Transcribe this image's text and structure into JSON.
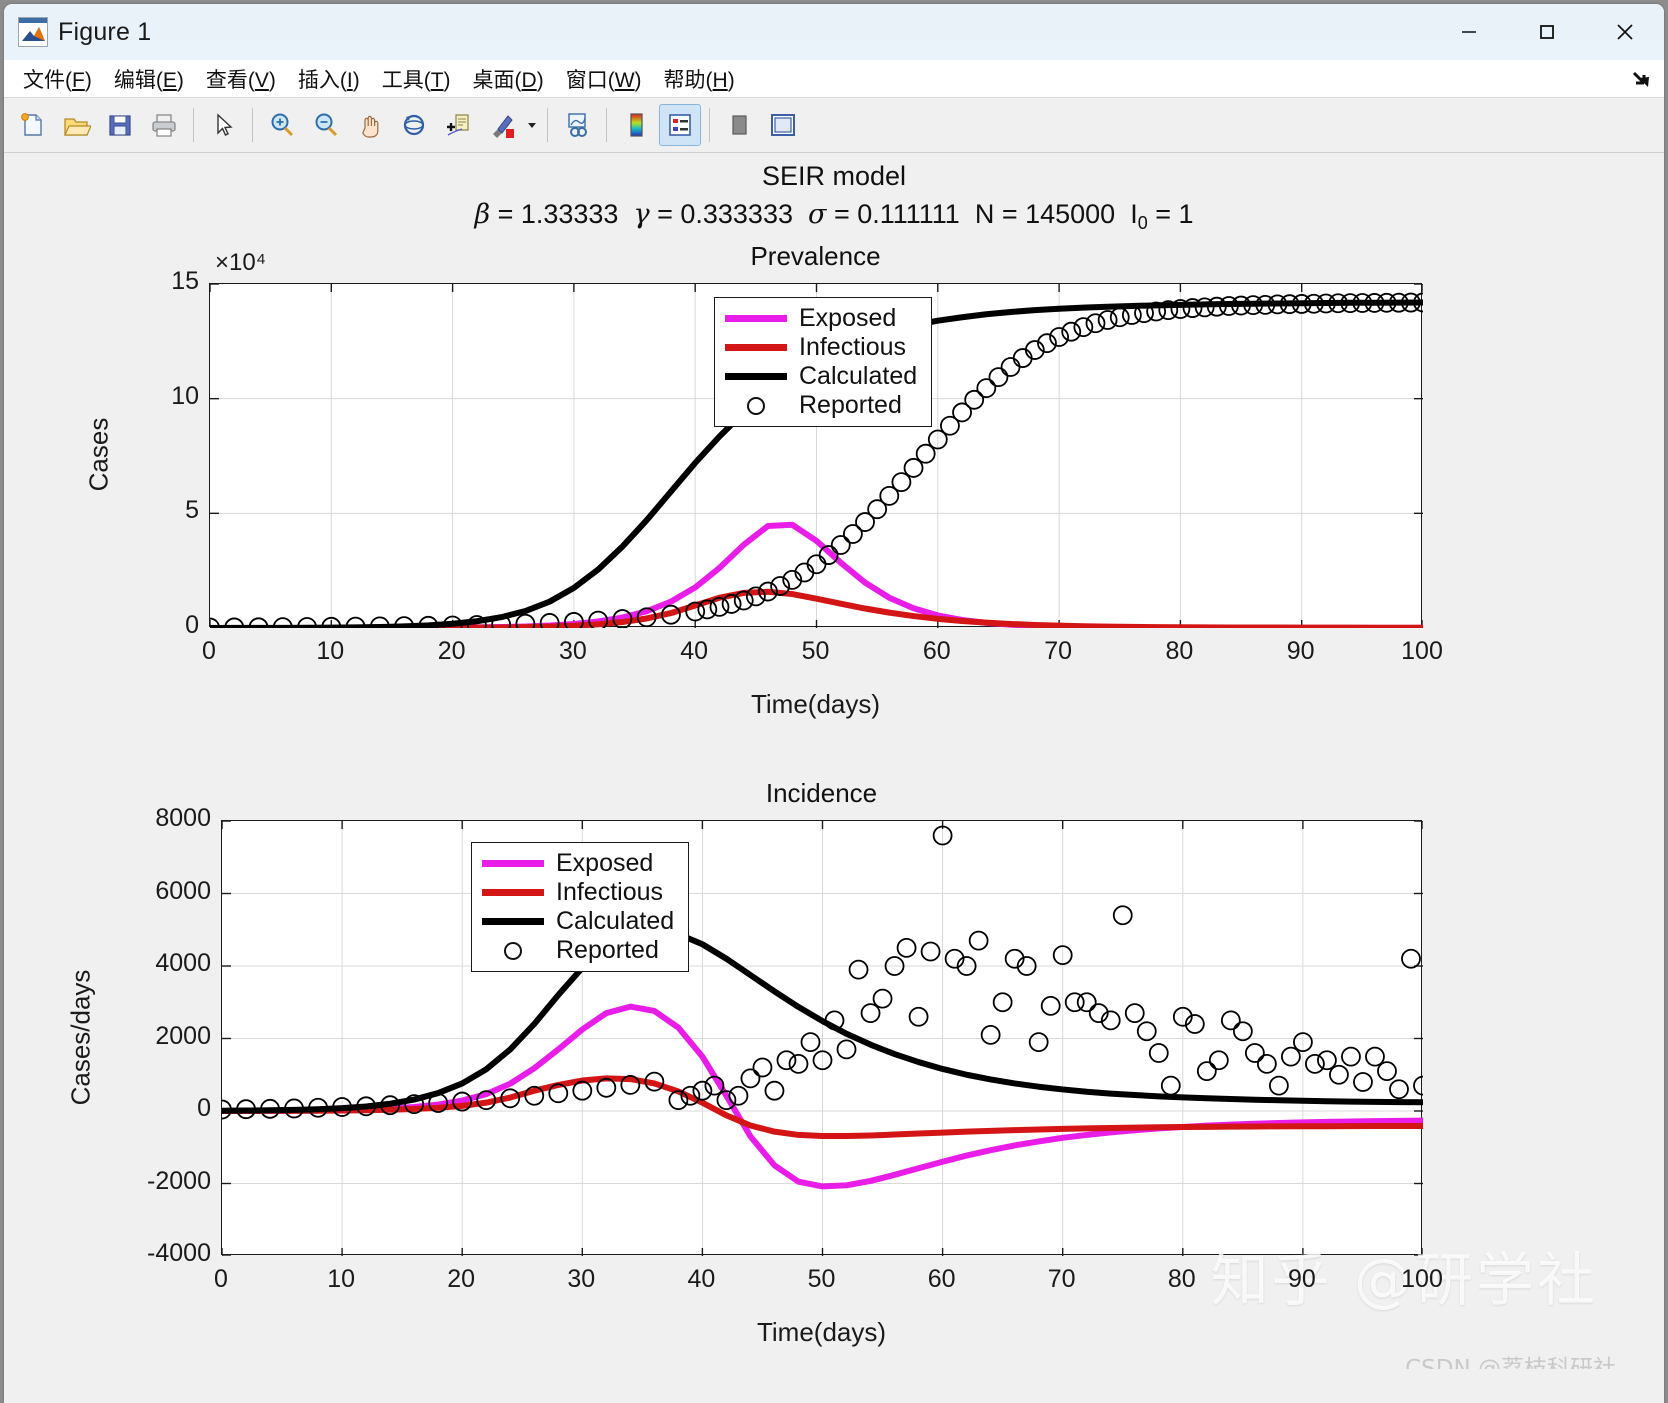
{
  "window": {
    "title": "Figure 1",
    "icon": "matlab-icon",
    "buttons": [
      {
        "name": "minimize-button",
        "glyph": "—"
      },
      {
        "name": "maximize-button",
        "glyph": "□"
      },
      {
        "name": "close-button",
        "glyph": "✕"
      }
    ]
  },
  "menubar": {
    "items": [
      {
        "name": "menu-file",
        "label": "文件(F)",
        "text": "文件(",
        "mn": "F",
        "tail": ")"
      },
      {
        "name": "menu-edit",
        "label": "编辑(E)",
        "text": "编辑(",
        "mn": "E",
        "tail": ")"
      },
      {
        "name": "menu-view",
        "label": "查看(V)",
        "text": "查看(",
        "mn": "V",
        "tail": ")"
      },
      {
        "name": "menu-insert",
        "label": "插入(I)",
        "text": "插入(",
        "mn": "I",
        "tail": ")"
      },
      {
        "name": "menu-tools",
        "label": "工具(T)",
        "text": "工具(",
        "mn": "T",
        "tail": ")"
      },
      {
        "name": "menu-desktop",
        "label": "桌面(D)",
        "text": "桌面(",
        "mn": "D",
        "tail": ")"
      },
      {
        "name": "menu-window",
        "label": "窗口(W)",
        "text": "窗口(",
        "mn": "W",
        "tail": ")"
      },
      {
        "name": "menu-help",
        "label": "帮助(H)",
        "text": "帮助(",
        "mn": "H",
        "tail": ")"
      }
    ],
    "dock_arrow": "dock-arrow-icon"
  },
  "toolbar": {
    "buttons": [
      {
        "name": "new-figure-icon",
        "tip": "New Figure"
      },
      {
        "name": "open-file-icon",
        "tip": "Open File"
      },
      {
        "name": "save-figure-icon",
        "tip": "Save Figure"
      },
      {
        "name": "print-figure-icon",
        "tip": "Print Figure"
      },
      {
        "name": "pointer-icon",
        "tip": "Edit Plot"
      },
      {
        "name": "zoom-in-icon",
        "tip": "Zoom In"
      },
      {
        "name": "zoom-out-icon",
        "tip": "Zoom Out"
      },
      {
        "name": "pan-hand-icon",
        "tip": "Pan"
      },
      {
        "name": "rotate-3d-icon",
        "tip": "Rotate 3D"
      },
      {
        "name": "data-cursor-icon",
        "tip": "Data Cursor"
      },
      {
        "name": "brush-icon",
        "tip": "Brush/Select Data"
      },
      {
        "name": "link-plot-icon",
        "tip": "Link Plot"
      },
      {
        "name": "colorbar-icon",
        "tip": "Insert Colorbar"
      },
      {
        "name": "legend-icon",
        "tip": "Insert Legend"
      },
      {
        "name": "hide-plot-tools-icon",
        "tip": "Hide Plot Tools"
      },
      {
        "name": "show-plot-tools-icon",
        "tip": "Show Plot Tools and Dock Figure"
      }
    ]
  },
  "figure": {
    "title": "SEIR model",
    "subtitle_parts": {
      "beta_sym": "β",
      "beta_val": " = 1.33333",
      "gamma_sym": "γ",
      "gamma_val": " = 0.333333",
      "sigma_sym": "σ",
      "sigma_val": " = 0.111111",
      "N_sym": "N",
      "N_val": " = 145000",
      "I0_sym": "I",
      "I0_sub": "0",
      "I0_val": " = 1"
    },
    "parameters": {
      "beta": 1.33333,
      "gamma": 0.333333,
      "sigma": 0.111111,
      "N": 145000,
      "I0": 1
    }
  },
  "watermarks": {
    "zhihu": "知乎 @研学社",
    "csdn": "CSDN @荔枝科研社"
  },
  "colors": {
    "exposed": "#e81ee8",
    "infectious": "#d41515",
    "calculated": "#000000",
    "reported_edge": "#000000",
    "figure_bg": "#f0f0f0",
    "axes_bg": "#ffffff",
    "grid": "#d9d9d9",
    "titlebar": "#e8f2f8"
  },
  "chart_data": [
    {
      "type": "line",
      "name": "prevalence-plot",
      "title": "Prevalence",
      "xlabel": "Time(days)",
      "ylabel": "Cases",
      "y_exponent_label": "×10⁴",
      "y_exponent": 10000,
      "xlim": [
        0,
        100
      ],
      "ylim": [
        0,
        150000
      ],
      "xticks": [
        0,
        10,
        20,
        30,
        40,
        50,
        60,
        70,
        80,
        90,
        100
      ],
      "yticks": [
        0,
        5,
        10,
        15
      ],
      "ytick_values": [
        0,
        50000,
        100000,
        150000
      ],
      "grid": true,
      "legend_position": "north-center",
      "legend": [
        "Exposed",
        "Infectious",
        "Calculated",
        "Reported"
      ],
      "x": [
        0,
        2,
        4,
        6,
        8,
        10,
        12,
        14,
        16,
        18,
        20,
        22,
        24,
        26,
        28,
        30,
        32,
        34,
        36,
        38,
        40,
        42,
        44,
        46,
        48,
        50,
        52,
        54,
        56,
        58,
        60,
        62,
        64,
        66,
        68,
        70,
        72,
        74,
        76,
        78,
        80,
        82,
        84,
        86,
        88,
        90,
        92,
        94,
        96,
        98,
        100
      ],
      "series": [
        {
          "name": "Exposed",
          "color": "#e81ee8",
          "values": [
            1,
            2,
            3,
            5,
            8,
            13,
            22,
            36,
            58,
            95,
            155,
            252,
            410,
            665,
            1080,
            1750,
            2830,
            4560,
            7300,
            11500,
            17700,
            26200,
            36300,
            44500,
            45000,
            38000,
            28500,
            19800,
            13200,
            8600,
            5500,
            3500,
            2250,
            1450,
            950,
            640,
            440,
            320,
            240,
            190,
            150,
            120,
            100,
            85,
            75,
            65,
            58,
            52,
            48,
            44,
            40
          ]
        },
        {
          "name": "Infectious",
          "color": "#d41515",
          "values": [
            1,
            1,
            2,
            3,
            5,
            8,
            13,
            21,
            34,
            55,
            89,
            145,
            235,
            380,
            615,
            995,
            1610,
            2600,
            4150,
            6500,
            9800,
            13200,
            15300,
            15800,
            14800,
            12800,
            10600,
            8500,
            6700,
            5200,
            4000,
            3050,
            2320,
            1760,
            1330,
            1010,
            780,
            610,
            490,
            400,
            335,
            285,
            245,
            215,
            190,
            170,
            155,
            142,
            132,
            123,
            115
          ]
        },
        {
          "name": "Calculated",
          "color": "#000000",
          "values": [
            20,
            30,
            45,
            70,
            110,
            175,
            280,
            450,
            720,
            1150,
            1850,
            2950,
            4700,
            7400,
            11500,
            17500,
            25500,
            35500,
            47000,
            59500,
            72000,
            83500,
            94000,
            103000,
            110500,
            117000,
            122000,
            126000,
            129500,
            132000,
            134000,
            135500,
            136800,
            137800,
            138600,
            139200,
            139700,
            140100,
            140400,
            140700,
            140900,
            141100,
            141300,
            141400,
            141500,
            141600,
            141700,
            141800,
            141850,
            141900,
            141950
          ]
        }
      ],
      "scatter": {
        "name": "Reported",
        "marker": "open-circle",
        "edge": "#000000",
        "x": [
          0,
          2,
          4,
          6,
          8,
          10,
          12,
          14,
          16,
          18,
          20,
          22,
          24,
          26,
          28,
          30,
          32,
          34,
          36,
          38,
          40,
          41,
          42,
          43,
          44,
          45,
          46,
          47,
          48,
          49,
          50,
          51,
          52,
          53,
          54,
          55,
          56,
          57,
          58,
          59,
          60,
          61,
          62,
          63,
          64,
          65,
          66,
          67,
          68,
          69,
          70,
          71,
          72,
          73,
          74,
          75,
          76,
          77,
          78,
          79,
          80,
          81,
          82,
          83,
          84,
          85,
          86,
          87,
          88,
          89,
          90,
          91,
          92,
          93,
          94,
          95,
          96,
          97,
          98,
          99,
          100
        ],
        "y": [
          200,
          250,
          300,
          380,
          450,
          520,
          600,
          700,
          820,
          950,
          1100,
          1300,
          1550,
          1850,
          2200,
          2650,
          3200,
          3900,
          4700,
          5800,
          7200,
          8100,
          9200,
          10500,
          12000,
          13800,
          15900,
          18300,
          21000,
          24200,
          27800,
          31800,
          36200,
          41000,
          46200,
          51800,
          57600,
          63600,
          69800,
          76000,
          82200,
          88200,
          94000,
          99500,
          104600,
          109400,
          113800,
          117700,
          121200,
          124200,
          126900,
          129200,
          131200,
          132900,
          134300,
          135500,
          136500,
          137300,
          138000,
          138600,
          139100,
          139500,
          139800,
          140100,
          140400,
          140600,
          140800,
          140900,
          141100,
          141200,
          141300,
          141400,
          141500,
          141600,
          141650,
          141700,
          141750,
          141800,
          141850,
          141900,
          141950
        ]
      }
    },
    {
      "type": "line",
      "name": "incidence-plot",
      "title": "Incidence",
      "xlabel": "Time(days)",
      "ylabel": "Cases/days",
      "xlim": [
        0,
        100
      ],
      "ylim": [
        -4000,
        8000
      ],
      "xticks": [
        0,
        10,
        20,
        30,
        40,
        50,
        60,
        70,
        80,
        90,
        100
      ],
      "yticks": [
        -4000,
        -2000,
        0,
        2000,
        4000,
        6000,
        8000
      ],
      "grid": true,
      "legend_position": "north-west",
      "legend": [
        "Exposed",
        "Infectious",
        "Calculated",
        "Reported"
      ],
      "x": [
        0,
        2,
        4,
        6,
        8,
        10,
        12,
        14,
        16,
        18,
        20,
        22,
        24,
        26,
        28,
        30,
        32,
        34,
        36,
        38,
        40,
        42,
        44,
        46,
        48,
        50,
        52,
        54,
        56,
        58,
        60,
        62,
        64,
        66,
        68,
        70,
        72,
        74,
        76,
        78,
        80,
        82,
        84,
        86,
        88,
        90,
        92,
        94,
        96,
        98,
        100
      ],
      "series": [
        {
          "name": "Exposed",
          "color": "#e81ee8",
          "values": [
            2,
            4,
            6,
            10,
            16,
            26,
            42,
            68,
            110,
            178,
            288,
            466,
            754,
            1180,
            1700,
            2250,
            2700,
            2880,
            2760,
            2300,
            1500,
            420,
            -700,
            -1500,
            -1950,
            -2080,
            -2050,
            -1930,
            -1760,
            -1580,
            -1400,
            -1230,
            -1080,
            -950,
            -840,
            -740,
            -660,
            -590,
            -530,
            -480,
            -440,
            -405,
            -375,
            -350,
            -330,
            -315,
            -300,
            -290,
            -280,
            -272,
            -265
          ]
        },
        {
          "name": "Infectious",
          "color": "#d41515",
          "values": [
            1,
            2,
            3,
            5,
            8,
            13,
            21,
            34,
            55,
            88,
            142,
            230,
            371,
            560,
            720,
            840,
            900,
            880,
            760,
            540,
            230,
            -120,
            -400,
            -570,
            -660,
            -690,
            -690,
            -675,
            -650,
            -622,
            -595,
            -570,
            -548,
            -528,
            -510,
            -494,
            -480,
            -468,
            -458,
            -450,
            -443,
            -437,
            -432,
            -428,
            -424,
            -421,
            -419,
            -417,
            -415,
            -413,
            -412
          ]
        },
        {
          "name": "Calculated",
          "color": "#000000",
          "values": [
            8,
            12,
            20,
            32,
            50,
            80,
            125,
            200,
            315,
            495,
            760,
            1150,
            1700,
            2400,
            3200,
            3950,
            4550,
            4900,
            5000,
            4880,
            4600,
            4200,
            3750,
            3300,
            2870,
            2480,
            2130,
            1830,
            1570,
            1350,
            1160,
            1000,
            870,
            760,
            670,
            595,
            530,
            480,
            440,
            405,
            375,
            350,
            330,
            312,
            296,
            282,
            270,
            260,
            252,
            245,
            240
          ]
        }
      ],
      "scatter": {
        "name": "Reported",
        "marker": "open-circle",
        "edge": "#000000",
        "x": [
          0,
          2,
          4,
          6,
          8,
          10,
          12,
          14,
          16,
          18,
          20,
          22,
          24,
          26,
          28,
          30,
          32,
          34,
          36,
          38,
          39,
          40,
          41,
          42,
          43,
          44,
          45,
          46,
          47,
          48,
          49,
          50,
          51,
          52,
          53,
          54,
          55,
          56,
          57,
          58,
          59,
          60,
          61,
          62,
          63,
          64,
          65,
          66,
          67,
          68,
          69,
          70,
          71,
          72,
          73,
          74,
          75,
          76,
          77,
          78,
          79,
          80,
          81,
          82,
          83,
          84,
          85,
          86,
          87,
          88,
          89,
          90,
          91,
          92,
          93,
          94,
          95,
          96,
          97,
          98,
          99,
          100
        ],
        "y": [
          40,
          50,
          60,
          70,
          90,
          110,
          130,
          160,
          190,
          220,
          260,
          300,
          350,
          420,
          490,
          560,
          640,
          720,
          810,
          300,
          420,
          560,
          700,
          300,
          420,
          900,
          1200,
          560,
          1400,
          1300,
          1900,
          1400,
          2500,
          1700,
          3900,
          2700,
          3100,
          4000,
          4500,
          2600,
          4400,
          7600,
          4200,
          4000,
          4700,
          2100,
          3000,
          4200,
          4000,
          1900,
          2900,
          4300,
          3000,
          3000,
          2700,
          2500,
          5400,
          2700,
          2200,
          1600,
          700,
          2600,
          2400,
          1100,
          1400,
          2500,
          2200,
          1600,
          1300,
          700,
          1500,
          1900,
          1300,
          1400,
          1000,
          1500,
          800,
          1500,
          1100,
          600,
          4200,
          700,
          600
        ]
      }
    }
  ]
}
